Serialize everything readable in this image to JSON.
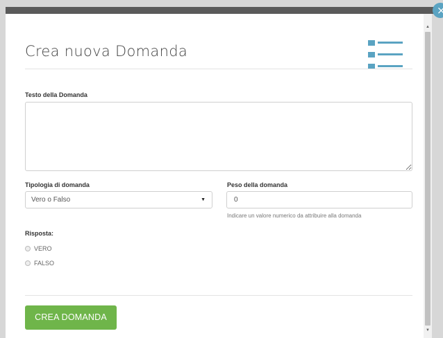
{
  "modal": {
    "title": "Crea nuova Domanda",
    "close_glyph": "×",
    "icon": "list-icon",
    "accent_color": "#5aa3c2"
  },
  "form": {
    "question_label": "Testo della Domanda",
    "question_value": "",
    "type_label": "Tipologia di domanda",
    "type_selected": "Vero o Falso",
    "weight_label": "Peso della domanda",
    "weight_value": "0",
    "weight_help": "Indicare un valore numerico da attribuire alla domanda",
    "answer_label": "Risposta:",
    "options": [
      "VERO",
      "FALSO"
    ],
    "submit_label": "CREA DOMANDA",
    "submit_color": "#6fb54a"
  }
}
